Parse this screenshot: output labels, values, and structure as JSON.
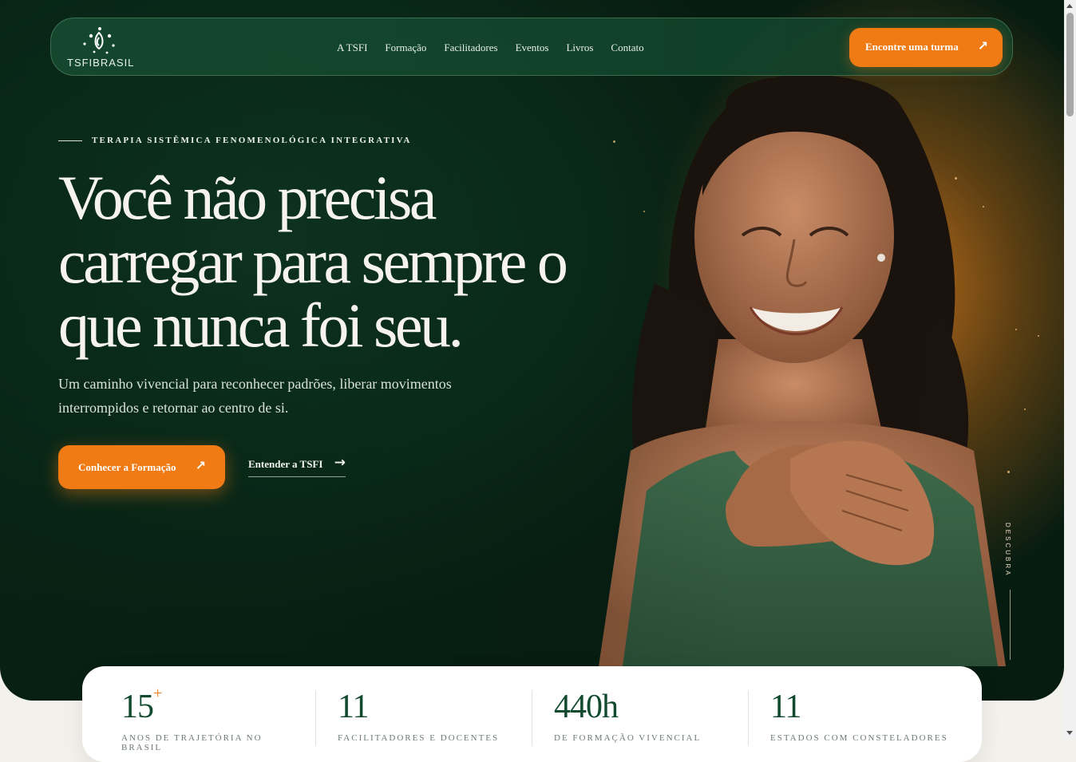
{
  "nav": {
    "logo_text": "TSFIBRASIL",
    "links": [
      "A TSFI",
      "Formação",
      "Facilitadores",
      "Eventos",
      "Livros",
      "Contato"
    ],
    "cta_label": "Encontre uma turma"
  },
  "hero": {
    "eyebrow": "TERAPIA SISTÊMICA FENOMENOLÓGICA INTEGRATIVA",
    "headline": "Você não precisa carregar para sempre o que nunca foi seu.",
    "subtitle": "Um caminho vivencial para reconhecer padrões, liberar movimentos interrompidos e retornar ao centro de si.",
    "primary_cta": "Conhecer a Formação",
    "secondary_cta": "Entender a TSFI",
    "scroll_cue": "DESCUBRA"
  },
  "stats": [
    {
      "value": "15",
      "suffix": "+",
      "label": "ANOS DE TRAJETÓRIA NO BRASIL"
    },
    {
      "value": "11",
      "suffix": "",
      "label": "FACILITADORES E DOCENTES"
    },
    {
      "value": "440h",
      "suffix": "",
      "label": "DE FORMAÇÃO VIVENCIAL"
    },
    {
      "value": "11",
      "suffix": "",
      "label": "ESTADOS COM CONSTELADORES"
    }
  ],
  "icons": {
    "cta_arrow": "arrow-up-right-icon",
    "link_arrow": "arrow-right-icon",
    "logo": "tsfi-logo-icon"
  },
  "colors": {
    "accent": "#f07a14",
    "hero_green": "#0c3320",
    "stat_number": "#114a2f",
    "page_bg": "#f3f1ec"
  }
}
